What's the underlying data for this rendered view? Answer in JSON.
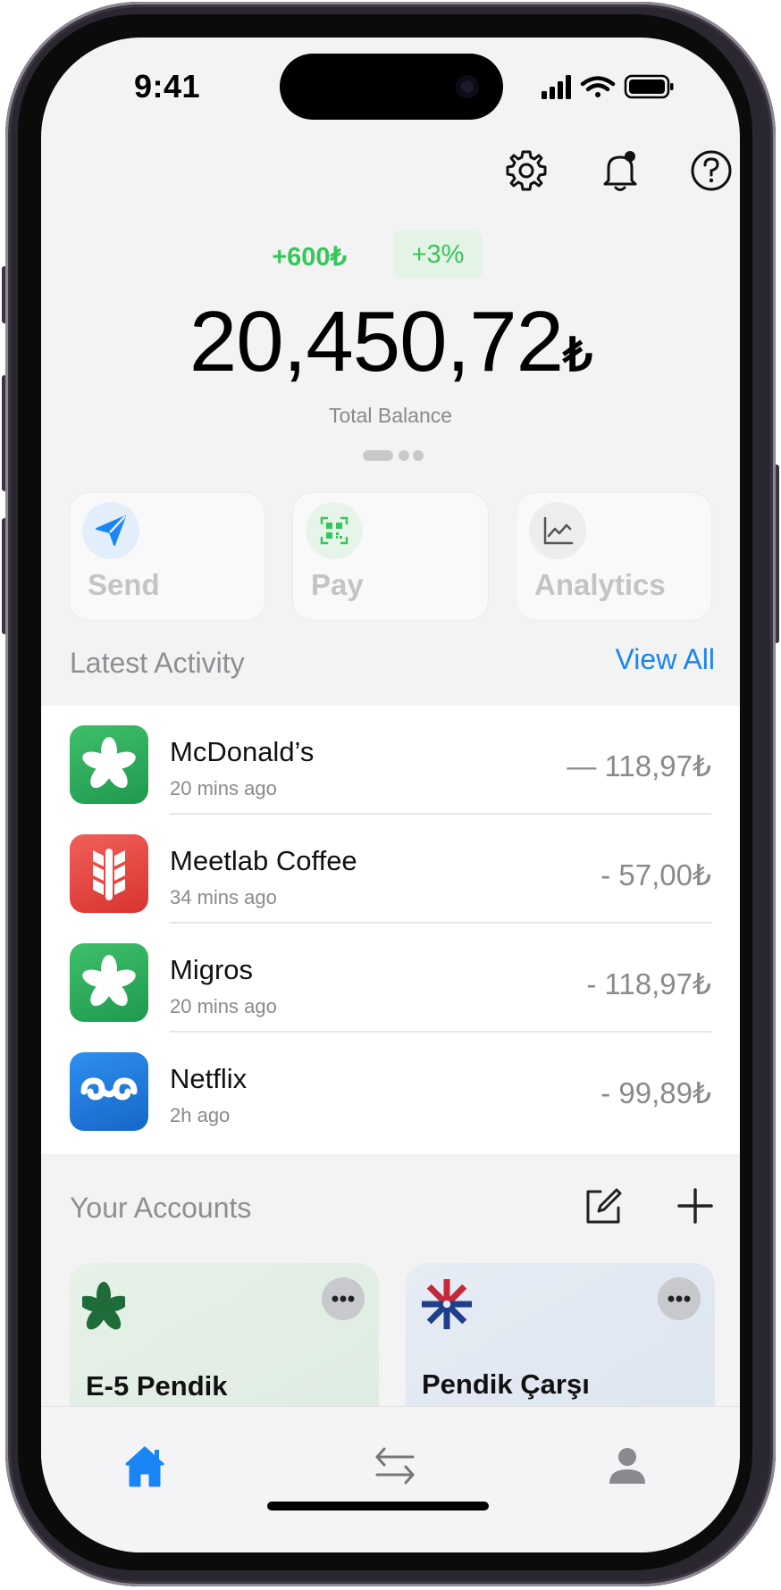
{
  "status_bar": {
    "time": "9:41"
  },
  "balance": {
    "delta_amount": "+600₺",
    "delta_percent": "+3%",
    "amount": "20,450,72",
    "currency": "₺",
    "label": "Total Balance"
  },
  "actions": [
    {
      "label": "Send",
      "icon": "send-icon"
    },
    {
      "label": "Pay",
      "icon": "qr-code-icon"
    },
    {
      "label": "Analytics",
      "icon": "chart-icon"
    }
  ],
  "activity": {
    "title": "Latest Activity",
    "view_all": "View All",
    "items": [
      {
        "merchant": "McDonald’s",
        "time": "20 mins ago",
        "amount": "— 118,97₺",
        "logo": "green-clover-logo"
      },
      {
        "merchant": "Meetlab Coffee",
        "time": "34 mins ago",
        "amount": "- 57,00₺",
        "logo": "red-wheat-logo"
      },
      {
        "merchant": "Migros",
        "time": "20 mins ago",
        "amount": "- 118,97₺",
        "logo": "green-clover-logo"
      },
      {
        "merchant": "Netflix",
        "time": "2h ago",
        "amount": "- 99,89₺",
        "logo": "blue-wave-logo"
      }
    ]
  },
  "accounts": {
    "title": "Your Accounts",
    "items": [
      {
        "name": "E-5 Pendik",
        "logo": "clover-logo"
      },
      {
        "name": "Pendik Çarşı",
        "logo": "star-logo"
      }
    ]
  },
  "tabbar": [
    "home-icon",
    "transfer-icon",
    "profile-icon"
  ],
  "colors": {
    "accent": "#1a85f4",
    "positive": "#34c759",
    "background": "#f3f3f4"
  }
}
